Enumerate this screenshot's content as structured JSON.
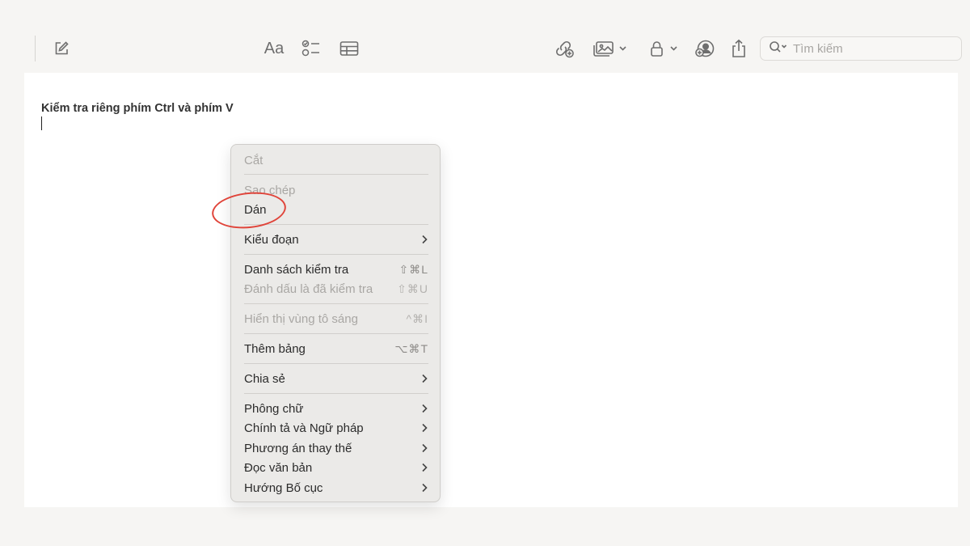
{
  "toolbar": {
    "compose_icon": "compose-icon",
    "format_label": "Aa",
    "search_placeholder": "Tìm kiếm",
    "accent": "#6e6e6e"
  },
  "note": {
    "title": "Kiểm tra riêng phím Ctrl và phím V"
  },
  "context_menu": {
    "items": [
      {
        "label": "Cắt",
        "disabled": true
      },
      {
        "label": "Sao chép",
        "disabled": true
      },
      {
        "label": "Dán",
        "disabled": false,
        "highlighted": true
      },
      {
        "label": "Kiểu đoạn",
        "submenu": true
      },
      {
        "label": "Danh sách kiểm tra",
        "shortcut": "⇧⌘L"
      },
      {
        "label": "Đánh dấu là đã kiểm tra",
        "shortcut": "⇧⌘U",
        "disabled": true
      },
      {
        "label": "Hiển thị vùng tô sáng",
        "shortcut": "^⌘I",
        "disabled": true
      },
      {
        "label": "Thêm bảng",
        "shortcut": "⌥⌘T"
      },
      {
        "label": "Chia sẻ",
        "submenu": true
      },
      {
        "label": "Phông chữ",
        "submenu": true
      },
      {
        "label": "Chính tả và Ngữ pháp",
        "submenu": true
      },
      {
        "label": "Phương án thay thế",
        "submenu": true
      },
      {
        "label": "Đọc văn bản",
        "submenu": true
      },
      {
        "label": "Hướng Bố cục",
        "submenu": true
      }
    ],
    "highlight_color": "#e0443a"
  }
}
